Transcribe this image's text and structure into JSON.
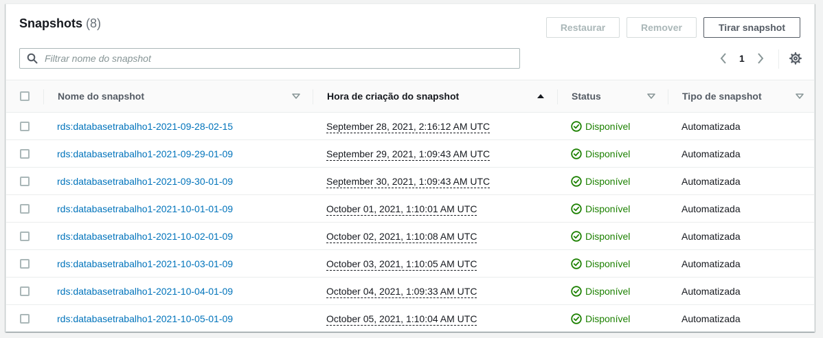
{
  "header": {
    "title": "Snapshots",
    "count": "(8)",
    "buttons": {
      "restore": "Restaurar",
      "remove": "Remover",
      "take": "Tirar snapshot"
    }
  },
  "search": {
    "placeholder": "Filtrar nome do snapshot",
    "value": ""
  },
  "pagination": {
    "current_page": "1"
  },
  "icons": {
    "search": "search-icon",
    "prev": "chevron-left-icon",
    "next": "chevron-right-icon",
    "settings": "gear-icon",
    "sort_desc": "caret-down-outline-icon",
    "sort_asc_active": "caret-up-filled-icon",
    "status_ok": "check-circle-icon"
  },
  "colors": {
    "link": "#0073bb",
    "success": "#1d8102",
    "disabled_text": "#aab7b8",
    "header_bg": "#fafafa"
  },
  "table": {
    "columns": [
      "Nome do snapshot",
      "Hora de criação do snapshot",
      "Status",
      "Tipo de snapshot"
    ],
    "rows": [
      {
        "name": "rds:databasetrabalho1-2021-09-28-02-15",
        "time": "September 28, 2021, 2:16:12 AM UTC",
        "status": "Disponível",
        "type": "Automatizada"
      },
      {
        "name": "rds:databasetrabalho1-2021-09-29-01-09",
        "time": "September 29, 2021, 1:09:43 AM UTC",
        "status": "Disponível",
        "type": "Automatizada"
      },
      {
        "name": "rds:databasetrabalho1-2021-09-30-01-09",
        "time": "September 30, 2021, 1:09:43 AM UTC",
        "status": "Disponível",
        "type": "Automatizada"
      },
      {
        "name": "rds:databasetrabalho1-2021-10-01-01-09",
        "time": "October 01, 2021, 1:10:01 AM UTC",
        "status": "Disponível",
        "type": "Automatizada"
      },
      {
        "name": "rds:databasetrabalho1-2021-10-02-01-09",
        "time": "October 02, 2021, 1:10:08 AM UTC",
        "status": "Disponível",
        "type": "Automatizada"
      },
      {
        "name": "rds:databasetrabalho1-2021-10-03-01-09",
        "time": "October 03, 2021, 1:10:05 AM UTC",
        "status": "Disponível",
        "type": "Automatizada"
      },
      {
        "name": "rds:databasetrabalho1-2021-10-04-01-09",
        "time": "October 04, 2021, 1:09:33 AM UTC",
        "status": "Disponível",
        "type": "Automatizada"
      },
      {
        "name": "rds:databasetrabalho1-2021-10-05-01-09",
        "time": "October 05, 2021, 1:10:04 AM UTC",
        "status": "Disponível",
        "type": "Automatizada"
      }
    ]
  }
}
